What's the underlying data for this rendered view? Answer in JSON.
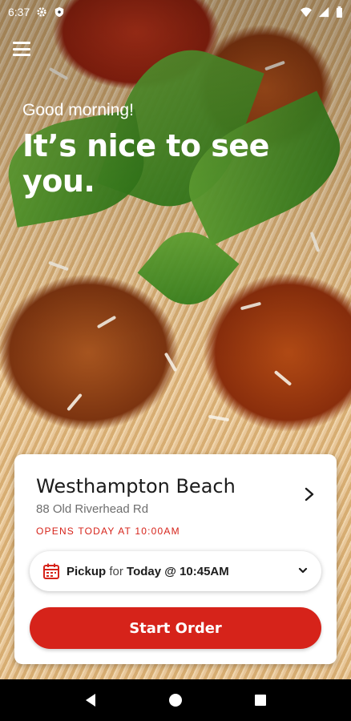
{
  "status_bar": {
    "time": "6:37",
    "icons_left": [
      "gear-icon",
      "shield-icon"
    ],
    "icons_right": [
      "wifi-icon",
      "signal-icon",
      "battery-icon"
    ]
  },
  "header": {
    "menu_icon": "hamburger-menu-icon",
    "greeting": "Good morning!",
    "headline": "It’s nice to see you."
  },
  "location_card": {
    "name": "Westhampton Beach",
    "address": "88 Old Riverhead Rd",
    "opens_text": "OPENS TODAY AT 10:00AM",
    "pickup": {
      "mode": "Pickup",
      "connector": "for",
      "time": "Today @ 10:45AM"
    },
    "start_order_label": "Start Order"
  },
  "colors": {
    "accent": "#d6231a",
    "text_dark": "#1c1c1c",
    "text_muted": "#6e6e6e"
  },
  "nav_bar": {
    "icons": [
      "back-icon",
      "home-icon",
      "recents-icon"
    ]
  }
}
